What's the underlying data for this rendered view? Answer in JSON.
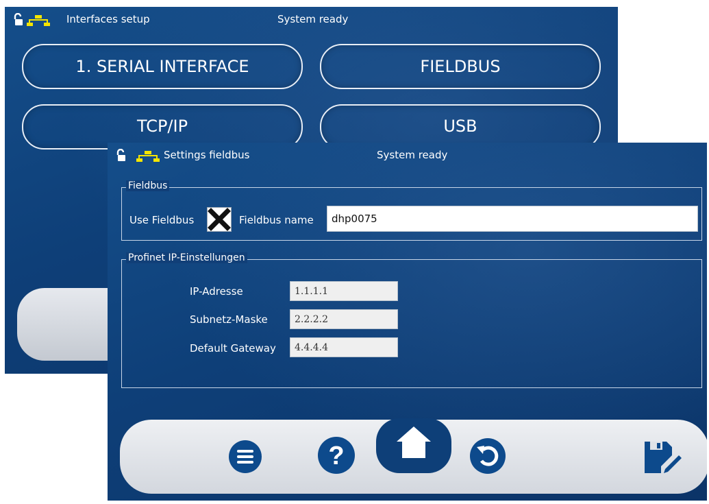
{
  "back_screen": {
    "title": "Interfaces setup",
    "status": "System ready",
    "buttons": [
      "1. SERIAL INTERFACE",
      "FIELDBUS",
      "TCP/IP",
      "USB"
    ]
  },
  "dialog": {
    "title": "Settings fieldbus",
    "status": "System ready",
    "fieldbus_group": {
      "legend": "Fieldbus",
      "use_label": "Use Fieldbus",
      "use_checked": true,
      "name_label": "Fieldbus name",
      "name_value": "dhp0075"
    },
    "profinet_group": {
      "legend": "Profinet IP-Einstellungen",
      "ip_label": "IP-Adresse",
      "ip_value": "1.1.1.1",
      "mask_label": "Subnetz-Maske",
      "mask_value": "2.2.2.2",
      "gateway_label": "Default Gateway",
      "gateway_value": "4.4.4.4"
    }
  },
  "icons": {
    "lock": "unlocked-padlock-icon",
    "network": "network-icon",
    "menu": "menu-icon",
    "help": "help-icon",
    "home": "home-icon",
    "back": "undo-icon",
    "save": "save-edit-icon"
  },
  "colors": {
    "background": "#0e3f78",
    "network_icon": "#f5e500",
    "nav_icon": "#0d4a8c",
    "panel": "#e6e9ee"
  }
}
